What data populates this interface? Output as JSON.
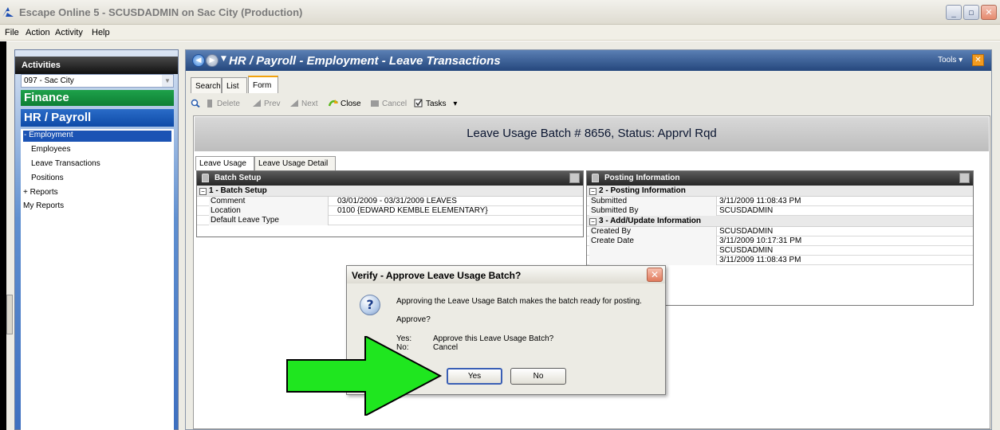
{
  "window": {
    "title": "Escape Online 5 - SCUSDADMIN on Sac City (Production)"
  },
  "menubar": [
    "File",
    "Action",
    "Activity",
    "Help"
  ],
  "sidebar": {
    "header": "Activities",
    "district": "097 - Sac City",
    "sections": [
      "Finance",
      "HR / Payroll"
    ],
    "tree": {
      "employment": "- Employment",
      "items": [
        "Employees",
        "Leave Transactions",
        "Positions"
      ],
      "reports": "+ Reports",
      "my_reports": "My Reports"
    }
  },
  "content": {
    "title": "HR / Payroll - Employment - Leave Transactions",
    "tools": "Tools ▾",
    "tabs": [
      "Search",
      "List",
      "Form"
    ],
    "toolbar": {
      "delete": "Delete",
      "prev": "Prev",
      "next": "Next",
      "close": "Close",
      "cancel": "Cancel",
      "tasks": "Tasks",
      "tasks_arrow": "▾"
    },
    "banner": "Leave Usage Batch # 8656, Status: Apprvl Rqd",
    "subtabs": [
      "Leave Usage",
      "Leave Usage Detail"
    ]
  },
  "batch_setup": {
    "header": "Batch Setup",
    "category": "1 - Batch Setup",
    "rows": [
      {
        "label": "Comment",
        "value": "03/01/2009 - 03/31/2009 LEAVES"
      },
      {
        "label": "Location",
        "value": "0100 {EDWARD KEMBLE ELEMENTARY}"
      },
      {
        "label": "Default Leave Type",
        "value": ""
      }
    ]
  },
  "posting": {
    "header": "Posting Information",
    "category1": "2 - Posting Information",
    "rows1": [
      {
        "label": "Submitted",
        "value": "3/11/2009 11:08:43 PM"
      },
      {
        "label": "Submitted By",
        "value": "SCUSDADMIN"
      }
    ],
    "category2": "3 - Add/Update Information",
    "rows2": [
      {
        "label": "Created By",
        "value": "SCUSDADMIN"
      },
      {
        "label": "Create Date",
        "value": "3/11/2009 10:17:31 PM"
      },
      {
        "label": "",
        "value": "SCUSDADMIN"
      },
      {
        "label": "",
        "value": "3/11/2009 11:08:43 PM"
      }
    ]
  },
  "dialog": {
    "title": "Verify - Approve Leave Usage Batch?",
    "message": "Approving the Leave Usage Batch makes the batch ready for posting.",
    "question": "Approve?",
    "yes_label": "Yes:",
    "yes_desc": "Approve this Leave Usage Batch?",
    "no_label": "No:",
    "no_desc": "Cancel",
    "yes_button": "Yes",
    "no_button": "No"
  },
  "colors": {
    "arrow": "#1fe61f",
    "finance": "#128a3c",
    "hr": "#1752b0"
  }
}
